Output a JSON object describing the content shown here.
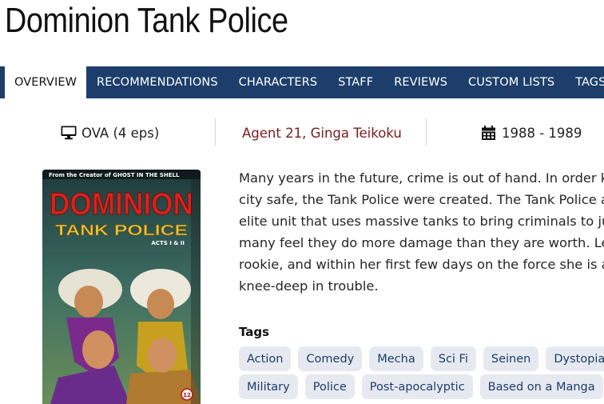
{
  "page": {
    "title": "Dominion Tank Police"
  },
  "tabs": [
    {
      "label": "OVERVIEW",
      "active": true
    },
    {
      "label": "RECOMMENDATIONS"
    },
    {
      "label": "CHARACTERS"
    },
    {
      "label": "STAFF"
    },
    {
      "label": "REVIEWS"
    },
    {
      "label": "CUSTOM LISTS"
    },
    {
      "label": "TAGS"
    }
  ],
  "info": {
    "type_icon": "monitor-icon",
    "type": "OVA (4 eps)",
    "studios": "Agent 21, Ginga Teikoku",
    "years_icon": "calendar-icon",
    "years": "1988 - 1989"
  },
  "cover": {
    "tagline": "From the Creator of GHOST IN THE SHELL",
    "logo_line1": "DOMINION",
    "logo_line2": "TANK POLICE",
    "logo_line3": "ACTS I & II",
    "rating": "12"
  },
  "description": {
    "lines": [
      "Many years in the future, crime is out of hand. In order ke",
      "city safe, the Tank Police were created. The Tank Police a",
      "elite unit that uses massive tanks to bring criminals to jus",
      "many feel they do more damage than they are worth. Le",
      "rookie, and within her first few days on the force she is a",
      "knee-deep in trouble."
    ]
  },
  "tags": {
    "heading": "Tags",
    "row1": [
      "Action",
      "Comedy",
      "Mecha",
      "Sci Fi",
      "Seinen",
      "Dystopia"
    ],
    "row2": [
      "Military",
      "Police",
      "Post-apocalyptic",
      "Based on a Manga"
    ]
  },
  "colors": {
    "nav_bg": "#1d3e6b",
    "studio_link": "#7a1b1b",
    "tag_bg": "#e6e9ef",
    "tag_text": "#1d3e6b"
  }
}
